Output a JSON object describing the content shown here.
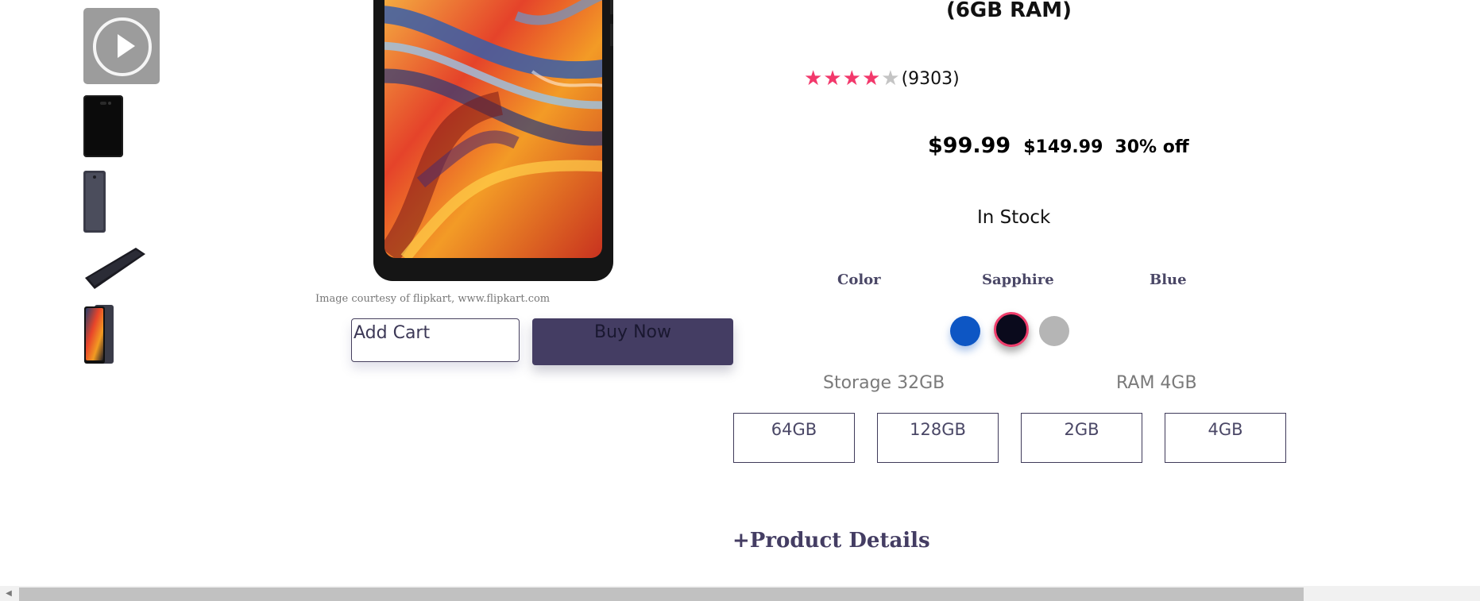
{
  "product": {
    "title": "(6GB RAM)",
    "rating": {
      "value": 4,
      "max": 5,
      "count_text": "(9303)"
    },
    "price": "$99.99",
    "mrp": "$149.99",
    "discount": "30% off",
    "stock": "In Stock",
    "image_credit": "Image courtesy of flipkart, www.flipkart.com"
  },
  "actions": {
    "add_cart_label": "Add Cart",
    "buy_now_label": "Buy Now"
  },
  "variants": {
    "labels": [
      "Color",
      "Sapphire",
      "Blue"
    ],
    "swatches": [
      {
        "name": "blue",
        "color": "#0d56c4"
      },
      {
        "name": "black",
        "color": "#0a0a1c",
        "selected": true
      },
      {
        "name": "grey",
        "color": "#b5b5b5"
      }
    ],
    "accent": "#ee3d6b"
  },
  "specs": {
    "storage_label": "Storage 32GB",
    "ram_label": "RAM 4GB",
    "options": [
      "64GB",
      "128GB",
      "2GB",
      "4GB"
    ]
  },
  "details": {
    "toggle_label": "+Product Details"
  },
  "thumbnails": [
    {
      "icon": "play-icon",
      "type": "video"
    },
    {
      "type": "phone-back-black"
    },
    {
      "type": "phone-side-grey"
    },
    {
      "type": "phone-flat"
    },
    {
      "type": "phone-front"
    }
  ],
  "colors": {
    "primary": "#443d63",
    "star": "#f2386b"
  }
}
